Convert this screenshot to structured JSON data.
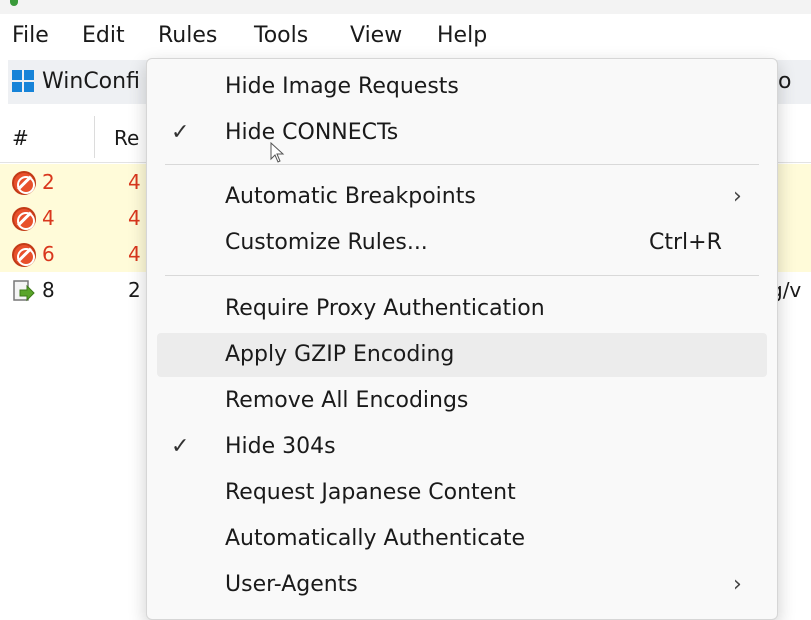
{
  "menubar": {
    "items": [
      "File",
      "Edit",
      "Rules",
      "Tools",
      "View",
      "Help"
    ]
  },
  "toolbar": {
    "winconfig_label": "WinConfi",
    "right_fragment": "o"
  },
  "sessions": {
    "headers": [
      "#",
      "Re"
    ],
    "rows": [
      {
        "id": "2",
        "code": "4",
        "status": "blocked",
        "tail": ""
      },
      {
        "id": "4",
        "code": "4",
        "status": "blocked",
        "tail": ""
      },
      {
        "id": "6",
        "code": "4",
        "status": "blocked",
        "tail": ""
      },
      {
        "id": "8",
        "code": "2",
        "status": "forward",
        "tail": "g/v"
      }
    ]
  },
  "rules_menu": {
    "items": [
      {
        "label": "Hide Image Requests",
        "checked": false
      },
      {
        "label": "Hide CONNECTs",
        "checked": true
      },
      {
        "label": "Automatic Breakpoints",
        "submenu": true
      },
      {
        "label": "Customize Rules...",
        "shortcut": "Ctrl+R"
      },
      {
        "label": "Require Proxy Authentication",
        "checked": false
      },
      {
        "label": "Apply GZIP Encoding",
        "checked": false,
        "highlighted": true
      },
      {
        "label": "Remove All Encodings",
        "checked": false
      },
      {
        "label": "Hide 304s",
        "checked": true
      },
      {
        "label": "Request Japanese Content",
        "checked": false
      },
      {
        "label": "Automatically Authenticate",
        "checked": false
      },
      {
        "label": "User-Agents",
        "submenu": true
      }
    ],
    "check_glyph": "✓",
    "arrow_glyph": "›"
  },
  "colors": {
    "error_row_bg": "#fffbd9",
    "error_text": "#d9371d",
    "windows_blue": "#1683d8"
  }
}
